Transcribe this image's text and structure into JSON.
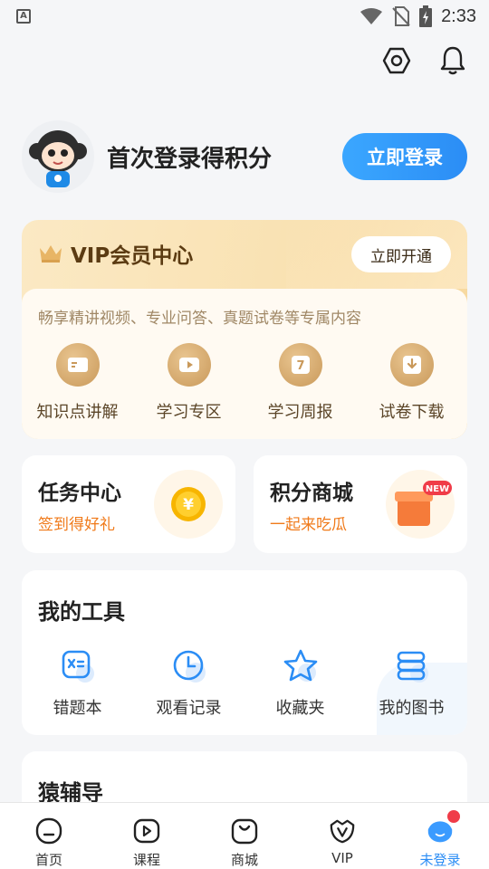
{
  "status_bar": {
    "time": "2:33",
    "keyboard_indicator": "A"
  },
  "top_actions": {
    "settings_icon": "settings-hexagon-icon",
    "bell_icon": "bell-icon"
  },
  "profile": {
    "prompt": "首次登录得积分",
    "login_button": "立即登录"
  },
  "vip": {
    "title": "VIP会员中心",
    "open_button": "立即开通",
    "description": "畅享精讲视频、专业问答、真题试卷等专属内容",
    "features": [
      {
        "label": "知识点讲解",
        "icon": "knowledge-icon"
      },
      {
        "label": "学习专区",
        "icon": "play-icon"
      },
      {
        "label": "学习周报",
        "icon": "calendar-7-icon"
      },
      {
        "label": "试卷下载",
        "icon": "download-icon"
      }
    ]
  },
  "task_center": {
    "title": "任务中心",
    "subtitle": "签到得好礼",
    "icon": "coin-icon",
    "icon_text": "¥"
  },
  "points_mall": {
    "title": "积分商城",
    "subtitle": "一起来吃瓜",
    "icon": "gift-box-icon",
    "badge": "NEW"
  },
  "tools": {
    "title": "我的工具",
    "items": [
      {
        "label": "错题本",
        "icon": "mistake-book-icon"
      },
      {
        "label": "观看记录",
        "icon": "clock-icon"
      },
      {
        "label": "收藏夹",
        "icon": "star-icon"
      },
      {
        "label": "我的图书",
        "icon": "books-icon"
      }
    ]
  },
  "fudao": {
    "title": "猿辅导"
  },
  "bottom_nav": {
    "items": [
      {
        "label": "首页",
        "icon": "home-icon"
      },
      {
        "label": "课程",
        "icon": "course-play-icon"
      },
      {
        "label": "商城",
        "icon": "shop-bag-icon"
      },
      {
        "label": "VIP",
        "icon": "vip-icon"
      },
      {
        "label": "未登录",
        "icon": "profile-avatar-icon"
      }
    ]
  },
  "colors": {
    "accent_blue": "#2b8df5",
    "orange_text": "#f07a1a",
    "vip_gold": "#f9e2b3",
    "red_dot": "#f03c48"
  }
}
